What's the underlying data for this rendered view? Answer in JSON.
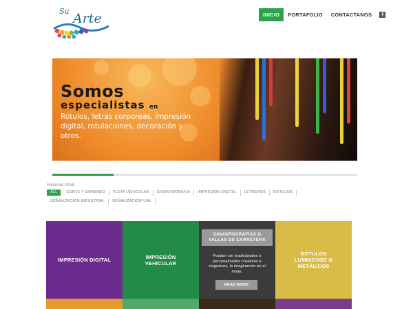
{
  "logo": {
    "line1": "Su",
    "line2": "Arte"
  },
  "nav": {
    "items": [
      {
        "label": "INICIO",
        "active": true
      },
      {
        "label": "PORTAFOLIO",
        "active": false
      },
      {
        "label": "CONTACTANOS",
        "active": false
      }
    ],
    "facebook": "f"
  },
  "banner": {
    "title": "Somos",
    "subtitle": "especialistas",
    "subtitle_suffix": "en",
    "body": "Rótulos, letras corporeas, impresión digital, rotulaciones, decoración y otros.",
    "progress_fraction": 0.2
  },
  "filters": {
    "label": "Featured Work:",
    "items": [
      "ALL",
      "CORTE Y GRABADO",
      "FLOTA VEHICULAR",
      "GIGANTOGRAFÍA",
      "IMPRESIÓN DIGITAL",
      "LETREROS",
      "RÓTULOS",
      "SEÑALIZACIÓN INDUSTRIAL",
      "SEÑALIZACIÓN VIAL"
    ],
    "active": "ALL"
  },
  "tiles": [
    {
      "label": "IMPRESIÓN DIGITAL",
      "color": "#6b2b8f",
      "strip_color": "#e89a2c"
    },
    {
      "label": "IMPRESIÓN VEHICULAR",
      "color": "#238b45",
      "strip_color": "#55a86b"
    },
    {
      "label": "GIGANTOGRAFÍAS O VALLAS DE CARRETERA",
      "color": "#3b3b3b",
      "strip_color": "#3a2a1c",
      "text": "Pueden ser tradicionales o personalizadas creativas o singulares, la imaginación es el límite.",
      "button": "READ MORE"
    },
    {
      "label": "RÓTULOS LUMINOSOS O METÁLICOS",
      "color": "#d8bc45",
      "strip_color": "#7a3d8c"
    }
  ]
}
